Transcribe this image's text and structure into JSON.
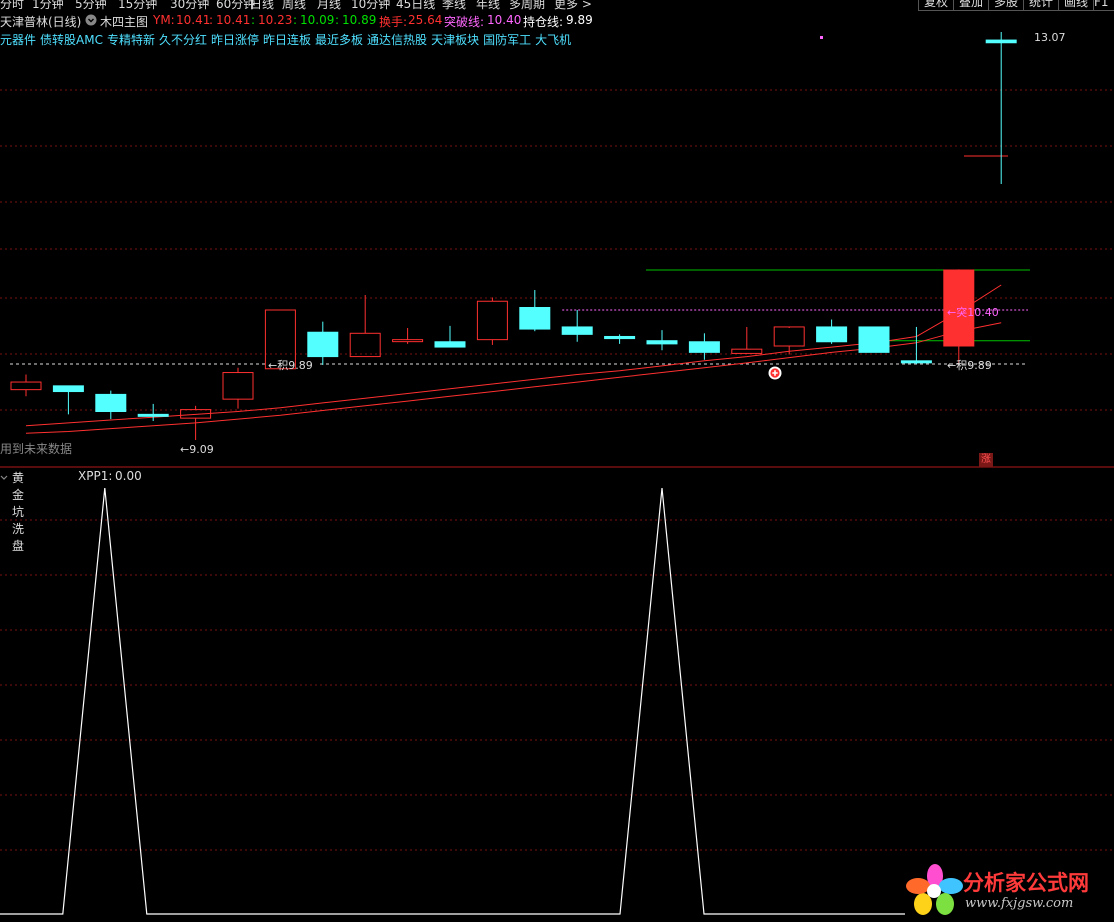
{
  "period_tabs": [
    "分时",
    "1分钟",
    "5分钟",
    "15分钟",
    "30分钟",
    "60分钟",
    "日线",
    "周线",
    "月线",
    "10分钟",
    "45日线",
    "季线",
    "年线",
    "多周期",
    "更多 >"
  ],
  "toolbar": {
    "fuquan": "复权",
    "diejia": "叠加",
    "duogu": "多股",
    "tongji": "统计",
    "huaxian": "画线",
    "f10": "F1"
  },
  "header": {
    "stock_name": "天津普林(日线)",
    "formula_icon": "settings-circle-icon",
    "formula_name": "木四主图",
    "ym_label": "YM:",
    "ym_values": [
      "10.41",
      "10.41",
      "10.23",
      "10.09",
      "10.89"
    ],
    "turnover_label": "换手:",
    "turnover_value": "25.64",
    "break_label": "突破线:",
    "break_value": "10.40",
    "hold_label": "持仓线:",
    "hold_value": "9.89"
  },
  "concept_tags": [
    "元器件",
    "债转股AMC",
    "专精特新",
    "久不分红",
    "昨日涨停",
    "昨日连板",
    "最近多板",
    "通达信热股",
    "天津板块",
    "国防军工",
    "大飞机"
  ],
  "annotations": {
    "price_1307": "13.07",
    "break_mark": "←突10.40",
    "hold_mark_right": "←积9.89",
    "hold_mark_left": "←积9.89",
    "low_mark": "←9.09",
    "future_data": "用到未来数据",
    "up_marker": "涨"
  },
  "indicator": {
    "title": "黄金坑洗盘",
    "label": "XPP1:",
    "value": "0.00"
  },
  "logo": {
    "brand": "分析家公式网",
    "url": "www.fxjgsw.com"
  },
  "colors": {
    "up": "#ff3030",
    "down": "#54ffff",
    "ma": "#ff3030",
    "break_line": "#ff66ff",
    "green_line": "#00c000",
    "grid": "#7a1010"
  },
  "chart_data": {
    "type": "candlestick",
    "candles": [
      {
        "o": 9.62,
        "h": 9.78,
        "l": 9.55,
        "c": 9.7,
        "dir": "up"
      },
      {
        "o": 9.66,
        "h": 9.66,
        "l": 9.36,
        "c": 9.6,
        "dir": "down"
      },
      {
        "o": 9.57,
        "h": 9.61,
        "l": 9.31,
        "c": 9.39,
        "dir": "down"
      },
      {
        "o": 9.36,
        "h": 9.47,
        "l": 9.29,
        "c": 9.35,
        "dir": "down"
      },
      {
        "o": 9.32,
        "h": 9.45,
        "l": 9.09,
        "c": 9.41,
        "dir": "up"
      },
      {
        "o": 9.52,
        "h": 9.85,
        "l": 9.42,
        "c": 9.8,
        "dir": "up"
      },
      {
        "o": 9.84,
        "h": 10.4,
        "l": 9.85,
        "c": 10.4,
        "dir": "up"
      },
      {
        "o": 10.19,
        "h": 10.29,
        "l": 9.88,
        "c": 9.96,
        "dir": "down"
      },
      {
        "o": 9.96,
        "h": 10.52,
        "l": 9.96,
        "c": 10.18,
        "dir": "up"
      },
      {
        "o": 10.12,
        "h": 10.23,
        "l": 10.08,
        "c": 10.12,
        "dir": "up"
      },
      {
        "o": 10.1,
        "h": 10.25,
        "l": 10.05,
        "c": 10.05,
        "dir": "down"
      },
      {
        "o": 10.12,
        "h": 10.5,
        "l": 10.07,
        "c": 10.47,
        "dir": "up"
      },
      {
        "o": 10.42,
        "h": 10.56,
        "l": 10.2,
        "c": 10.22,
        "dir": "down"
      },
      {
        "o": 10.24,
        "h": 10.4,
        "l": 10.1,
        "c": 10.17,
        "dir": "down"
      },
      {
        "o": 10.15,
        "h": 10.17,
        "l": 10.08,
        "c": 10.13,
        "dir": "down"
      },
      {
        "o": 10.11,
        "h": 10.21,
        "l": 10.02,
        "c": 10.08,
        "dir": "down"
      },
      {
        "o": 10.1,
        "h": 10.18,
        "l": 9.93,
        "c": 10.0,
        "dir": "down"
      },
      {
        "o": 9.99,
        "h": 10.24,
        "l": 9.99,
        "c": 10.03,
        "dir": "up"
      },
      {
        "o": 10.06,
        "h": 10.23,
        "l": 9.98,
        "c": 10.24,
        "dir": "up"
      },
      {
        "o": 10.24,
        "h": 10.31,
        "l": 10.08,
        "c": 10.1,
        "dir": "down"
      },
      {
        "o": 10.24,
        "h": 10.24,
        "l": 10.04,
        "c": 10.0,
        "dir": "down"
      },
      {
        "o": 9.92,
        "h": 10.24,
        "l": 9.89,
        "c": 9.91,
        "dir": "down"
      },
      {
        "o": 10.06,
        "h": 10.73,
        "l": 9.9,
        "c": 10.72,
        "dir": "up"
      },
      {
        "o": 13.07,
        "h": 13.13,
        "l": 12.0,
        "c": 13.05,
        "dir": "down"
      }
    ],
    "ma_lines": [
      {
        "name": "MA1",
        "values": [
          9.24,
          9.27,
          9.3,
          9.33,
          9.36,
          9.39,
          9.43,
          9.48,
          9.53,
          9.58,
          9.63,
          9.68,
          9.73,
          9.78,
          9.82,
          9.87,
          9.92,
          9.96,
          10.01,
          10.05,
          10.09,
          10.15,
          10.38,
          10.6
        ]
      },
      {
        "name": "MA2",
        "values": [
          9.16,
          9.18,
          9.21,
          9.24,
          9.27,
          9.31,
          9.35,
          9.4,
          9.45,
          9.5,
          9.55,
          9.6,
          9.65,
          9.7,
          9.75,
          9.8,
          9.85,
          9.9,
          9.95,
          10.0,
          10.04,
          10.09,
          10.2,
          10.28
        ]
      }
    ],
    "hlines": [
      {
        "name": "突破线",
        "value": 10.4
      },
      {
        "name": "持仓线",
        "value": 9.89
      },
      {
        "name": "绿线",
        "value": 10.11
      },
      {
        "name": "上绿线",
        "value": 10.72
      }
    ],
    "indicator_series": {
      "name": "XPP1",
      "values": [
        0,
        0,
        1,
        0,
        0,
        0,
        0,
        0,
        0,
        0,
        0,
        0,
        0,
        0,
        0,
        1,
        0,
        0,
        0,
        0,
        0,
        0,
        0,
        0
      ]
    }
  }
}
